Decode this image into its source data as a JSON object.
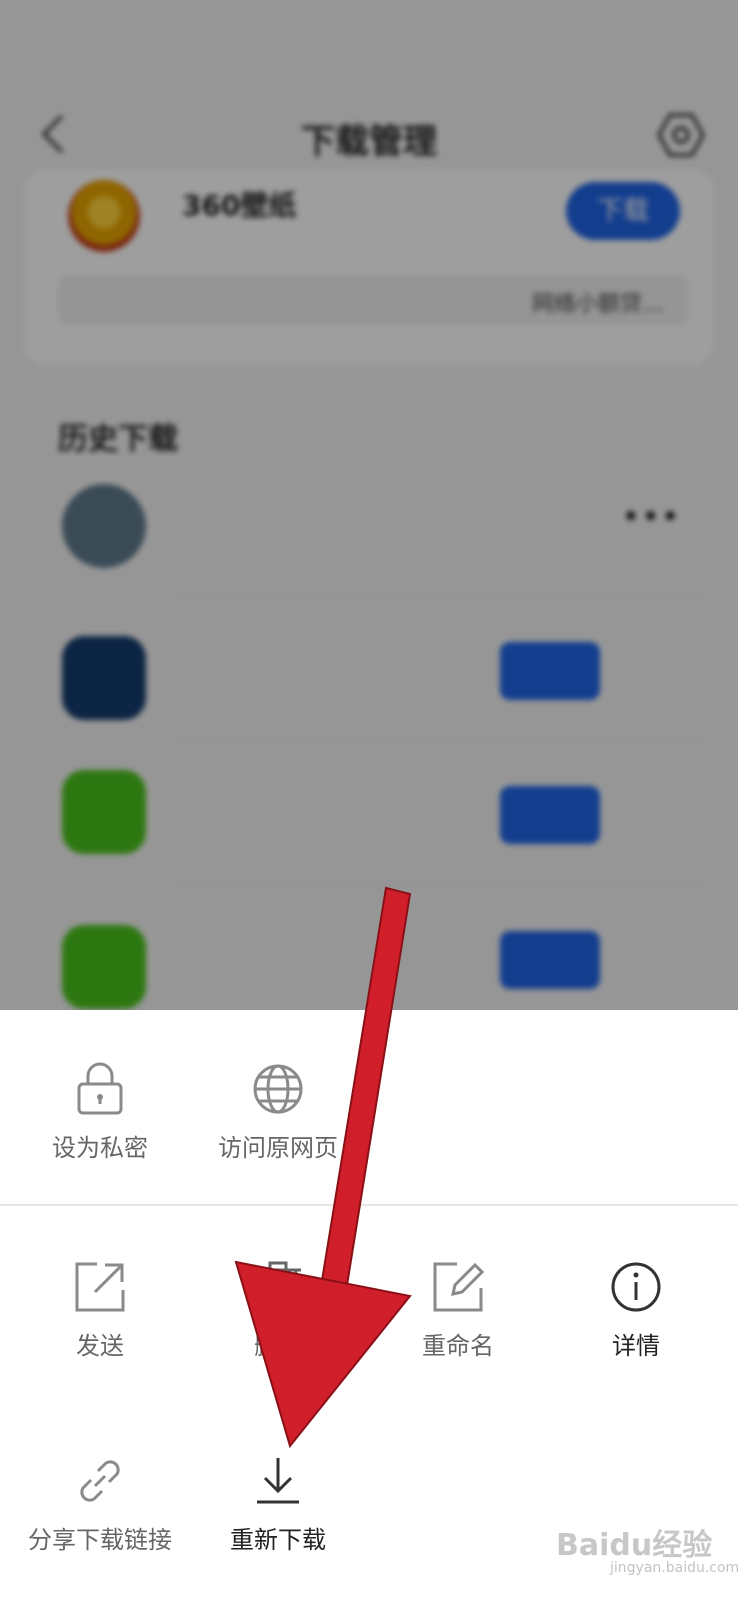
{
  "status_bar": {
    "left": "",
    "right": ""
  },
  "nav": {
    "title": "下载管理"
  },
  "active_download": {
    "name": "360壁纸",
    "subtitle": "",
    "button_label": "下载",
    "url_text": "",
    "ad_text": "网络小额贷…"
  },
  "history": {
    "title": "历史下载",
    "items": [
      {
        "name": "",
        "meta": "",
        "button": "",
        "size": "",
        "icon_color": "#5e7a8c",
        "more": "•••"
      },
      {
        "name": "",
        "meta": "",
        "button": "",
        "size": "",
        "icon_color": "#153c6e",
        "more": ""
      },
      {
        "name": "",
        "meta": "",
        "button": "",
        "size": "",
        "icon_color": "#49c11b",
        "more": ""
      },
      {
        "name": "",
        "meta": "",
        "button": "",
        "size": "",
        "icon_color": "#49c11b",
        "more": ""
      }
    ]
  },
  "sheet": {
    "row1": [
      {
        "label": "设为私密",
        "icon": "lock-icon"
      },
      {
        "label": "访问原网页",
        "icon": "globe-icon"
      }
    ],
    "row2": [
      {
        "label": "发送",
        "icon": "send-icon"
      },
      {
        "label": "删除",
        "icon": "trash-icon"
      },
      {
        "label": "重命名",
        "icon": "edit-icon"
      },
      {
        "label": "详情",
        "icon": "info-icon"
      }
    ],
    "row3": [
      {
        "label": "分享下载链接",
        "icon": "link-icon"
      },
      {
        "label": "重新下载",
        "icon": "download-icon"
      }
    ]
  },
  "watermark": {
    "brand": "Baidu经验",
    "url": "jingyan.baidu.com"
  },
  "colors": {
    "accent": "#1f64e6",
    "arrow": "#d01f2a",
    "icon_gray": "#8a8a8a"
  }
}
